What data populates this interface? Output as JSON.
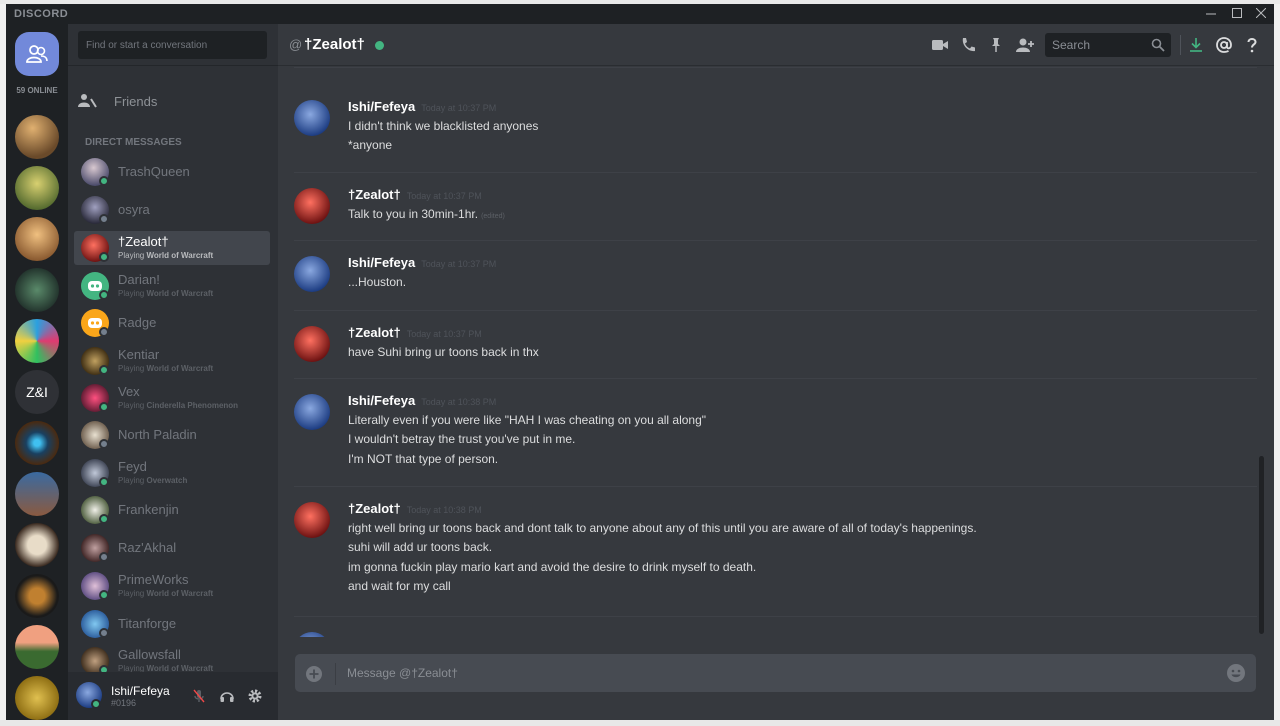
{
  "app": {
    "brand": "DISCORD"
  },
  "rail": {
    "online_label": "59 ONLINE",
    "zi_label": "Z&I"
  },
  "dms": {
    "search_placeholder": "Find or start a conversation",
    "friends_label": "Friends",
    "section_header": "DIRECT MESSAGES",
    "items": [
      {
        "name": "TrashQueen",
        "activity_prefix": "",
        "activity": "",
        "status": "online",
        "active": false
      },
      {
        "name": "osyra",
        "activity_prefix": "",
        "activity": "",
        "status": "offline",
        "active": false
      },
      {
        "name": "†Zealot†",
        "activity_prefix": "Playing",
        "activity": "World of Warcraft",
        "status": "online",
        "active": true
      },
      {
        "name": "Darian!",
        "activity_prefix": "Playing",
        "activity": "World of Warcraft",
        "status": "online",
        "active": false
      },
      {
        "name": "Radge",
        "activity_prefix": "",
        "activity": "",
        "status": "offline",
        "active": false
      },
      {
        "name": "Kentiar",
        "activity_prefix": "Playing",
        "activity": "World of Warcraft",
        "status": "online",
        "active": false
      },
      {
        "name": "Vex",
        "activity_prefix": "Playing",
        "activity": "Cinderella Phenomenon",
        "status": "online",
        "active": false
      },
      {
        "name": "North Paladin",
        "activity_prefix": "",
        "activity": "",
        "status": "offline",
        "active": false
      },
      {
        "name": "Feyd",
        "activity_prefix": "Playing",
        "activity": "Overwatch",
        "status": "online",
        "active": false
      },
      {
        "name": "Frankenjin",
        "activity_prefix": "",
        "activity": "",
        "status": "online",
        "active": false
      },
      {
        "name": "Raz'Akhal",
        "activity_prefix": "",
        "activity": "",
        "status": "offline",
        "active": false
      },
      {
        "name": "PrimeWorks",
        "activity_prefix": "Playing",
        "activity": "World of Warcraft",
        "status": "online",
        "active": false
      },
      {
        "name": "Titanforge",
        "activity_prefix": "",
        "activity": "",
        "status": "offline",
        "active": false
      },
      {
        "name": "Gallowsfall",
        "activity_prefix": "Playing",
        "activity": "World of Warcraft",
        "status": "online",
        "active": false
      }
    ]
  },
  "user": {
    "name": "Ishi/Fefeya",
    "tag": "#0196"
  },
  "channel": {
    "at": "@",
    "name": "†Zealot†"
  },
  "toolbar": {
    "search_placeholder": "Search"
  },
  "messages": [
    {
      "author": "Ishi/Fefeya",
      "timestamp": "Today at 10:37 PM",
      "lines": [
        "I didn't think we blacklisted anyones",
        "*anyone"
      ]
    },
    {
      "author": "†Zealot†",
      "timestamp": "Today at 10:37 PM",
      "lines": [
        "Talk to you in 30min-1hr."
      ],
      "edited": "(edited)"
    },
    {
      "author": "Ishi/Fefeya",
      "timestamp": "Today at 10:37 PM",
      "lines": [
        "...Houston."
      ]
    },
    {
      "author": "†Zealot†",
      "timestamp": "Today at 10:37 PM",
      "lines": [
        "have Suhi bring ur toons back in thx"
      ]
    },
    {
      "author": "Ishi/Fefeya",
      "timestamp": "Today at 10:38 PM",
      "lines": [
        "Literally even if you were like \"HAH I was cheating on you all along\"",
        "I wouldn't betray the trust you've put in me.",
        "I'm NOT that type of person."
      ]
    },
    {
      "author": "†Zealot†",
      "timestamp": "Today at 10:38 PM",
      "lines": [
        "right well bring ur toons back and dont talk to anyone about any of this until you are aware of all of today's happenings.",
        "suhi will add ur toons back.",
        "im gonna fuckin play mario kart and avoid the desire to drink myself to death.",
        "and wait for my call"
      ]
    }
  ],
  "composer": {
    "placeholder": "Message @†Zealot†"
  },
  "colors": {
    "accent": "#7289da",
    "online": "#43b581",
    "background": "#36393e",
    "sidebar": "#2e3136",
    "rail": "#1e2124"
  }
}
